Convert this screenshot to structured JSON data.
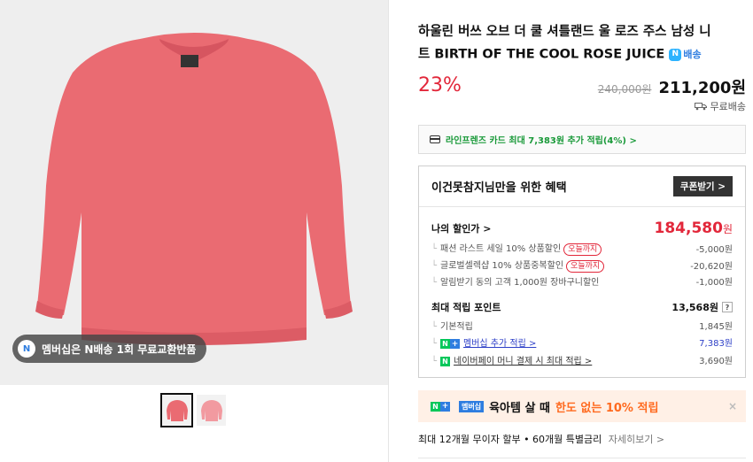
{
  "product": {
    "title_line1": "하울린 버쓰 오브 더 쿨 셔틀랜드 울 로즈 주스 남성 니",
    "title_line2": "트 BIRTH OF THE COOL ROSE JUICE",
    "delivery_badge": "배송",
    "discount_rate": "23%",
    "original_price": "240,000원",
    "sale_price": "211,200원",
    "shipping": "무료배송"
  },
  "image": {
    "membership_pill": "멤버십은 N배송 1회 무료교환반품",
    "sweater_color": "#ea6b72",
    "thumbnails": [
      {
        "label": "thumb-1"
      },
      {
        "label": "thumb-2"
      }
    ]
  },
  "card_promo": "라인프렌즈 카드 최대 7,383원 추가 적립(4%) >",
  "benefit": {
    "title": "이건못참지님만을 위한 혜택",
    "coupon_button": "쿠폰받기 >",
    "my_price_label": "나의 할인가 >",
    "my_price": "184,580",
    "my_price_unit": "원",
    "discounts": [
      {
        "label": "패션 라스트 세일 10% 상품할인",
        "tag": "오늘까지",
        "value": "-5,000원"
      },
      {
        "label": "글로벌셀렉샵 10% 상품중복할인",
        "tag": "오늘까지",
        "value": "-20,620원"
      },
      {
        "label": "알림받기 동의 고객 1,000원 장바구니할인",
        "tag": "",
        "value": "-1,000원"
      }
    ],
    "points_label": "최대 적립 포인트",
    "points_value": "13,568원",
    "points_help": "?",
    "points": [
      {
        "label": "기본적립",
        "value": "1,845원"
      },
      {
        "label": "멤버십 추가 적립 >",
        "value": "7,383원"
      },
      {
        "label": "네이버페이 머니 결제 시 최대 적립 >",
        "value": "3,690원"
      }
    ]
  },
  "promo": {
    "tag": "멤버십",
    "text1": "육아템 살 때",
    "text2": "한도 없는 10% 적립",
    "close": "×"
  },
  "installment": {
    "text": "최대 12개월 무이자 할부 • 60개월 특별금리",
    "more": "자세히보기 >"
  },
  "colors": {
    "accent_red": "#e2273a",
    "naver_green": "#03c75a",
    "link_blue": "#2d3fc7"
  }
}
